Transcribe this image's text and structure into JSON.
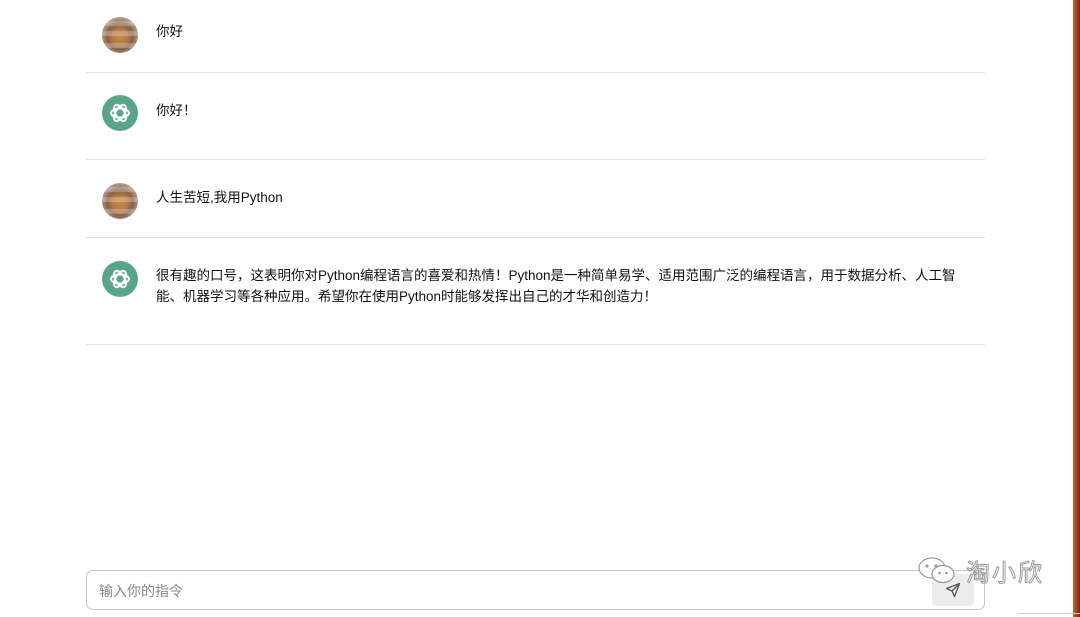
{
  "messages": [
    {
      "role": "user",
      "avatar_icon": "shiba-dog-avatar",
      "text": "你好"
    },
    {
      "role": "assistant",
      "avatar_icon": "openai-logo-icon",
      "text": "你好！"
    },
    {
      "role": "user",
      "avatar_icon": "shiba-dog-avatar",
      "text": "人生苦短,我用Python"
    },
    {
      "role": "assistant",
      "avatar_icon": "openai-logo-icon",
      "text": "很有趣的口号，这表明你对Python编程语言的喜爱和热情！Python是一种简单易学、适用范围广泛的编程语言，用于数据分析、人工智能、机器学习等各种应用。希望你在使用Python时能够发挥出自己的才华和创造力！"
    }
  ],
  "input": {
    "placeholder": "输入你的指令",
    "value": ""
  },
  "send_button": {
    "icon": "send-icon"
  },
  "watermark": {
    "icon": "wechat-icon",
    "text": "淘小欣"
  },
  "colors": {
    "assistant_avatar_bg": "#5aa58a",
    "divider": "#e3e3e3",
    "input_border": "#c7c7c7",
    "send_button_bg": "#ececec"
  }
}
